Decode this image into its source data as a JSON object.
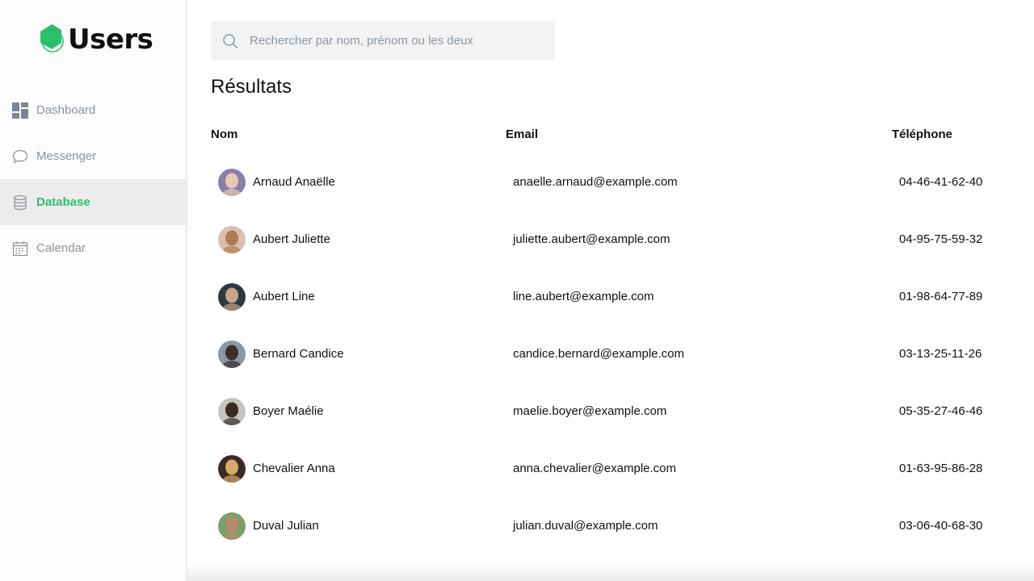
{
  "app": {
    "title": "Users",
    "brand_color": "#2dbe6c"
  },
  "sidebar": {
    "items": [
      {
        "label": "Dashboard",
        "icon": "dashboard-grid-icon",
        "active": false
      },
      {
        "label": "Messenger",
        "icon": "chat-bubble-icon",
        "active": false
      },
      {
        "label": "Database",
        "icon": "database-icon",
        "active": true
      },
      {
        "label": "Calendar",
        "icon": "calendar-icon",
        "active": false
      }
    ]
  },
  "search": {
    "placeholder": "Rechercher par nom, prénom ou les deux",
    "value": "",
    "icon": "search-icon"
  },
  "results": {
    "title": "Résultats",
    "columns": {
      "name": "Nom",
      "email": "Email",
      "phone": "Téléphone"
    },
    "rows": [
      {
        "name": "Arnaud Anaëlle",
        "email": "anaelle.arnaud@example.com",
        "phone": "04-46-41-62-40",
        "avatar_bg": "#8a7fa6",
        "avatar_fg": "#e9c9b4"
      },
      {
        "name": "Aubert Juliette",
        "email": "juliette.aubert@example.com",
        "phone": "04-95-75-59-32",
        "avatar_bg": "#d8c0b0",
        "avatar_fg": "#b07a55"
      },
      {
        "name": "Aubert Line",
        "email": "line.aubert@example.com",
        "phone": "01-98-64-77-89",
        "avatar_bg": "#2a3a40",
        "avatar_fg": "#c9a38c"
      },
      {
        "name": "Bernard Candice",
        "email": "candice.bernard@example.com",
        "phone": "03-13-25-11-26",
        "avatar_bg": "#8d96a3",
        "avatar_fg": "#3b2f2a"
      },
      {
        "name": "Boyer Maélie",
        "email": "maelie.boyer@example.com",
        "phone": "05-35-27-46-46",
        "avatar_bg": "#c9c3bb",
        "avatar_fg": "#3a2a22"
      },
      {
        "name": "Chevalier Anna",
        "email": "anna.chevalier@example.com",
        "phone": "01-63-95-86-28",
        "avatar_bg": "#3b2a24",
        "avatar_fg": "#d9a96b"
      },
      {
        "name": "Duval Julian",
        "email": "julian.duval@example.com",
        "phone": "03-06-40-68-30",
        "avatar_bg": "#7aa06a",
        "avatar_fg": "#b58a6a"
      }
    ]
  }
}
